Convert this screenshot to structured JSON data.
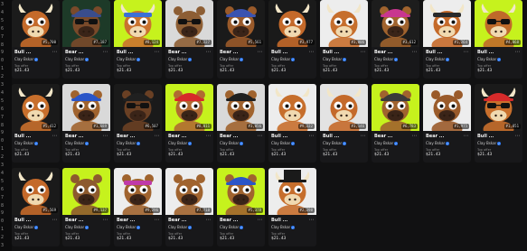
{
  "gutter_numbers": [
    "3",
    "4",
    "5",
    "6",
    "7",
    "8",
    "9",
    "0",
    "1",
    "2",
    "3",
    "4",
    "5",
    "6",
    "7",
    "8",
    "9",
    "0",
    "1",
    "2",
    "3",
    "4",
    "5",
    "6",
    "7",
    "8",
    "9",
    "0",
    "1",
    "2",
    "3"
  ],
  "cards": [
    {
      "name": "Bull ...",
      "id": "#5,700",
      "creator": "Clay Bskar",
      "label": "Top offer",
      "price": "$21.43",
      "bg": "#1b1b1b",
      "fur": "#c46a2a",
      "hat": "none",
      "hatColor": "#000",
      "glasses": false
    },
    {
      "name": "Bear ...",
      "id": "#7,187",
      "creator": "Clay Bskar",
      "label": "Top offer",
      "price": "$21.43",
      "bg": "#1d3a28",
      "fur": "#7a4a2a",
      "hat": "cap",
      "hatColor": "#3a4d8c",
      "glasses": true
    },
    {
      "name": "Bull ...",
      "id": "#8,124",
      "creator": "Clay Bskar",
      "label": "Top offer",
      "price": "$21.43",
      "bg": "#c6f21d",
      "fur": "#c9722f",
      "hat": "band",
      "hatColor": "#3c6fd6",
      "glasses": false
    },
    {
      "name": "Bear ...",
      "id": "#7,227",
      "creator": "Clay Bskar",
      "label": "Top offer",
      "price": "$21.43",
      "bg": "#d9d9d9",
      "fur": "#8d5e34",
      "hat": "none",
      "hatColor": "#000",
      "glasses": true
    },
    {
      "name": "Bear ...",
      "id": "#5,561",
      "creator": "Clay Bskar",
      "label": "Top offer",
      "price": "$21.43",
      "bg": "#1a1a1a",
      "fur": "#9a5a2a",
      "hat": "cap",
      "hatColor": "#3b53b0",
      "glasses": false
    },
    {
      "name": "Bull ...",
      "id": "#3,977",
      "creator": "Clay Bskar",
      "label": "Top offer",
      "price": "$21.43",
      "bg": "#1a1a1a",
      "fur": "#c4692a",
      "hat": "none",
      "hatColor": "#000",
      "glasses": false
    },
    {
      "name": "Bull ...",
      "id": "#3,806",
      "creator": "Clay Bskar",
      "label": "Top offer",
      "price": "$21.43",
      "bg": "#ededed",
      "fur": "#c66e2c",
      "hat": "none",
      "hatColor": "#000",
      "glasses": false
    },
    {
      "name": "Bear ...",
      "id": "#3,612",
      "creator": "Clay Bskar",
      "label": "Top offer",
      "price": "$21.43",
      "bg": "#1d1d1d",
      "fur": "#a0632e",
      "hat": "cap",
      "hatColor": "#c9368f",
      "glasses": false
    },
    {
      "name": "Bull ...",
      "id": "#1,264",
      "creator": "Clay Bskar",
      "label": "Top offer",
      "price": "$21.43",
      "bg": "#ededed",
      "fur": "#c4692a",
      "hat": "band",
      "hatColor": "#2a2a2a",
      "glasses": false
    },
    {
      "name": "Bull ...",
      "id": "#4,868",
      "creator": "Clay Bskar",
      "label": "Top offer",
      "price": "$21.43",
      "bg": "#c6f21d",
      "fur": "#bf6a2a",
      "hat": "none",
      "hatColor": "#000",
      "glasses": true
    },
    {
      "name": "Bull ...",
      "id": "#5,412",
      "creator": "Clay Bskar",
      "label": "Top offer",
      "price": "$21.43",
      "bg": "#1a1a1a",
      "fur": "#c86f2c",
      "hat": "none",
      "hatColor": "#000",
      "glasses": false
    },
    {
      "name": "Bear ...",
      "id": "#1,689",
      "creator": "Clay Bskar",
      "label": "Top offer",
      "price": "$21.43",
      "bg": "#d9d9d9",
      "fur": "#a0632e",
      "hat": "cap",
      "hatColor": "#2a55c8",
      "glasses": false
    },
    {
      "name": "Bear ...",
      "id": "#6,507",
      "creator": "Clay Bskar",
      "label": "Top offer",
      "price": "$21.43",
      "bg": "#1a1a1a",
      "fur": "#6a4024",
      "hat": "cap",
      "hatColor": "#202020",
      "glasses": true
    },
    {
      "name": "Bear ...",
      "id": "#8,011",
      "creator": "Clay Bskar",
      "label": "Top offer",
      "price": "$21.43",
      "bg": "#c6f21d",
      "fur": "#b06a32",
      "hat": "cap",
      "hatColor": "#d62a2a",
      "glasses": false
    },
    {
      "name": "Bear ...",
      "id": "#3,056",
      "creator": "Clay Bskar",
      "label": "Top offer",
      "price": "$21.43",
      "bg": "#d9d9d9",
      "fur": "#a0632e",
      "hat": "cap",
      "hatColor": "#202020",
      "glasses": false
    },
    {
      "name": "Bull ...",
      "id": "#9,222",
      "creator": "Clay Bskar",
      "label": "Top offer",
      "price": "$21.43",
      "bg": "#ededed",
      "fur": "#c66e2c",
      "hat": "none",
      "hatColor": "#000",
      "glasses": false
    },
    {
      "name": "Bull ...",
      "id": "#3,146",
      "creator": "Clay Bskar",
      "label": "Top offer",
      "price": "$21.43",
      "bg": "#e3e3e3",
      "fur": "#c4692a",
      "hat": "none",
      "hatColor": "#000",
      "glasses": false
    },
    {
      "name": "Bear ...",
      "id": "#6,783",
      "creator": "Clay Bskar",
      "label": "Top offer",
      "price": "$21.43",
      "bg": "#c6f21d",
      "fur": "#a0632e",
      "hat": "cap",
      "hatColor": "#3a3a3a",
      "glasses": false
    },
    {
      "name": "Bear ...",
      "id": "#1,975",
      "creator": "Clay Bskar",
      "label": "Top offer",
      "price": "$21.43",
      "bg": "#ededed",
      "fur": "#9a5a2a",
      "hat": "none",
      "hatColor": "#000",
      "glasses": false
    },
    {
      "name": "Bull ...",
      "id": "#1,851",
      "creator": "Clay Bskar",
      "label": "Top offer",
      "price": "$21.43",
      "bg": "#1a1a1a",
      "fur": "#c86f2c",
      "hat": "cap",
      "hatColor": "#d62a2a",
      "glasses": true
    },
    {
      "name": "Bull ...",
      "id": "#5,569",
      "creator": "Clay Bskar",
      "label": "Top offer",
      "price": "$21.43",
      "bg": "#1a1a1a",
      "fur": "#c4692a",
      "hat": "none",
      "hatColor": "#000",
      "glasses": false
    },
    {
      "name": "Bear ...",
      "id": "#9,137",
      "creator": "Clay Bskar",
      "label": "Top offer",
      "price": "$21.43",
      "bg": "#c6f21d",
      "fur": "#8d5a2e",
      "hat": "none",
      "hatColor": "#000",
      "glasses": false
    },
    {
      "name": "Bear ...",
      "id": "#9,296",
      "creator": "Clay Bskar",
      "label": "Top offer",
      "price": "$21.43",
      "bg": "#ededed",
      "fur": "#a0632e",
      "hat": "band",
      "hatColor": "#c03aa8",
      "glasses": false
    },
    {
      "name": "Bear ...",
      "id": "#7,718",
      "creator": "Clay Bskar",
      "label": "Top offer",
      "price": "$21.43",
      "bg": "#ededed",
      "fur": "#a0632e",
      "hat": "none",
      "hatColor": "#000",
      "glasses": false
    },
    {
      "name": "Bear ...",
      "id": "#5,378",
      "creator": "Clay Bskar",
      "label": "Top offer",
      "price": "$21.43",
      "bg": "#c6f21d",
      "fur": "#a0632e",
      "hat": "cap",
      "hatColor": "#2a55c8",
      "glasses": false
    },
    {
      "name": "Bull ...",
      "id": "#2,298",
      "creator": "Clay Bskar",
      "label": "Top offer",
      "price": "$21.43",
      "bg": "#ededed",
      "fur": "#c66e2c",
      "hat": "tophat",
      "hatColor": "#1a1a1a",
      "glasses": false
    }
  ]
}
